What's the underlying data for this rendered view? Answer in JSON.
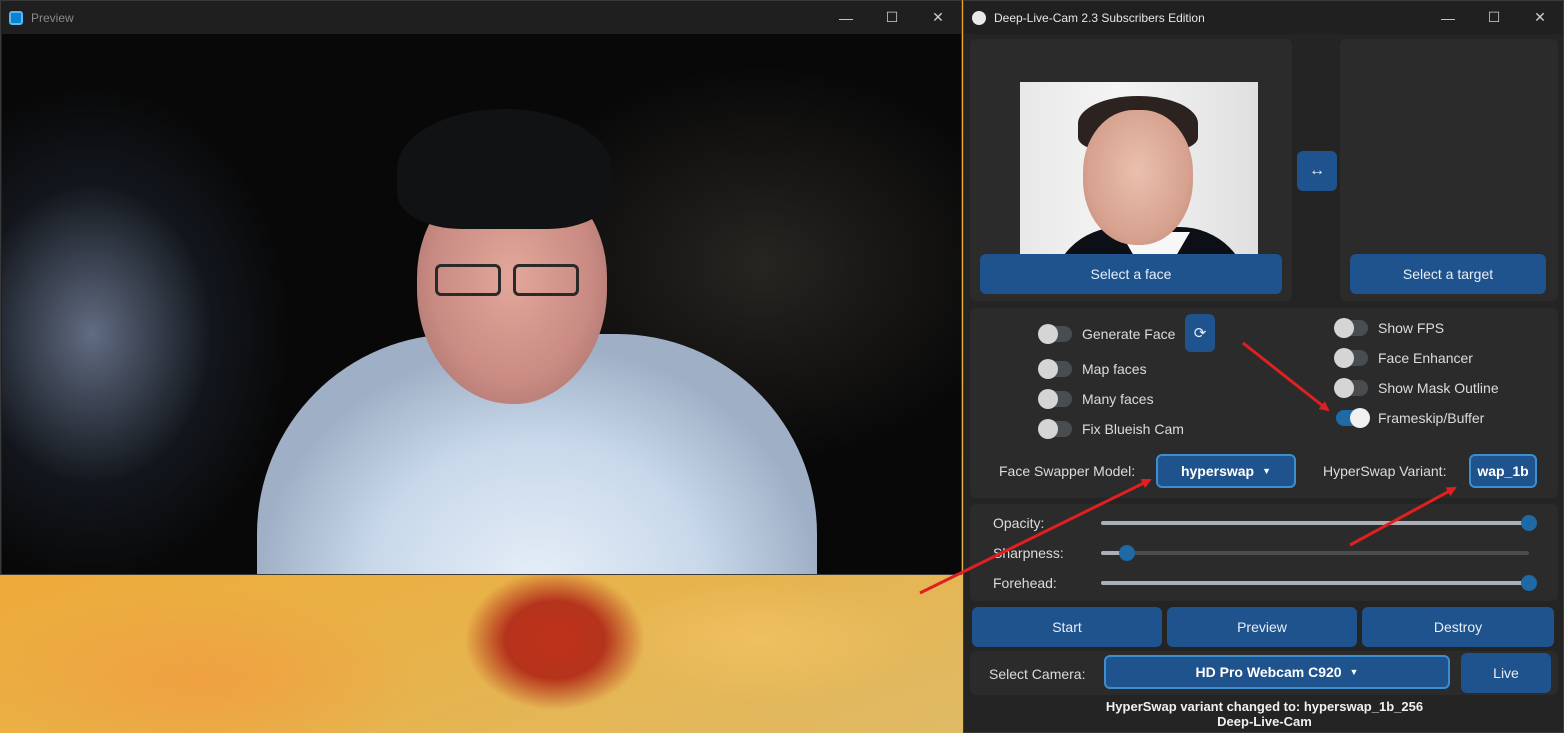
{
  "preview_window": {
    "title": "Preview",
    "controls": {
      "minimize": "—",
      "maximize": "☐",
      "close": "✕"
    }
  },
  "main_window": {
    "title": "Deep-Live-Cam 2.3 Subscribers Edition",
    "controls": {
      "minimize": "—",
      "maximize": "☐",
      "close": "✕"
    },
    "source": {
      "select_face_label": "Select a face"
    },
    "swap_button": "↔",
    "target": {
      "select_target_label": "Select a target"
    },
    "options_left": [
      {
        "label": "Generate Face",
        "on": false
      },
      {
        "label": "Map faces",
        "on": false
      },
      {
        "label": "Many faces",
        "on": false
      },
      {
        "label": "Fix Blueish Cam",
        "on": false
      }
    ],
    "refresh_icon": "⟳",
    "options_right": [
      {
        "label": "Show FPS",
        "on": false
      },
      {
        "label": "Face Enhancer",
        "on": false
      },
      {
        "label": "Show Mask Outline",
        "on": false
      },
      {
        "label": "Frameskip/Buffer",
        "on": true
      }
    ],
    "face_swapper_model": {
      "label": "Face Swapper Model:",
      "value": "hyperswap",
      "arrow": "▼"
    },
    "hyperswap_variant": {
      "label": "HyperSwap Variant:",
      "value": "wap_1b"
    },
    "sliders": [
      {
        "label": "Opacity:",
        "value": 1.0
      },
      {
        "label": "Sharpness:",
        "value": 0.06
      },
      {
        "label": "Forehead:",
        "value": 1.0
      }
    ],
    "actions": {
      "start": "Start",
      "preview": "Preview",
      "destroy": "Destroy"
    },
    "camera": {
      "label": "Select Camera:",
      "value": "HD Pro Webcam C920",
      "arrow": "▼",
      "live": "Live"
    },
    "status_line": "HyperSwap variant changed to: hyperswap_1b_256",
    "footer": "Deep-Live-Cam"
  },
  "colors": {
    "accent": "#1f538d",
    "accent_border": "#3b8ed0",
    "arrow": "#e02020"
  }
}
